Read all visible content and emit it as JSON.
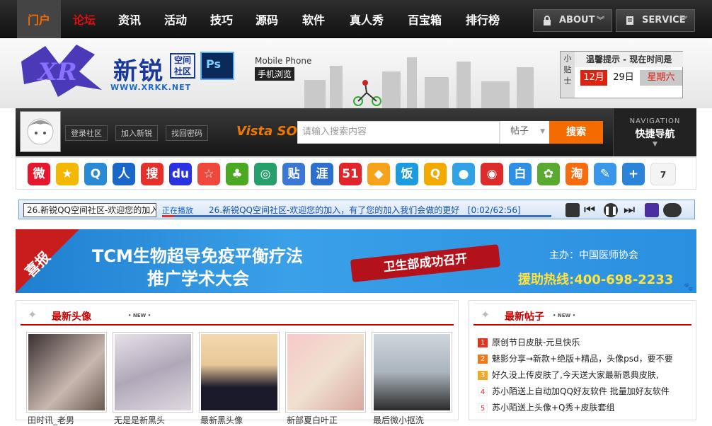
{
  "nav": [
    {
      "label": "门户",
      "state": "active"
    },
    {
      "label": "论坛",
      "state": "red"
    },
    {
      "label": "资讯",
      "state": ""
    },
    {
      "label": "活动",
      "state": ""
    },
    {
      "label": "技巧",
      "state": ""
    },
    {
      "label": "源码",
      "state": ""
    },
    {
      "label": "软件",
      "state": ""
    },
    {
      "label": "真人秀",
      "state": ""
    },
    {
      "label": "百宝箱",
      "state": ""
    },
    {
      "label": "排行榜",
      "state": ""
    }
  ],
  "top_buttons": {
    "about": "ABOUT",
    "service": "SERVICE"
  },
  "logo": {
    "name": "新锐",
    "sub": "空间社区",
    "url": "WWW.XRKK.NET",
    "ps": "Ps"
  },
  "mobile": {
    "line1": "Mobile Phone",
    "line2": "手机浏览"
  },
  "tip": {
    "side": "小贴士",
    "title": "温馨提示 - 现在时间是",
    "month": "12月",
    "day": "29日",
    "weekday": "星期六"
  },
  "user": {
    "login": "登录社区",
    "join": "加入新锐",
    "forgot": "找回密码"
  },
  "search": {
    "brand": "Vista SO",
    "placeholder": "请输入搜索内容",
    "type": "帖子",
    "button": "搜索"
  },
  "quicknav": {
    "en": "NAVIGATION",
    "cn": "快捷导航"
  },
  "apps": [
    {
      "name": "weibo-icon",
      "glyph": "微",
      "color": "#e6162d"
    },
    {
      "name": "qzone-star-icon",
      "glyph": "★",
      "color": "#f5b800"
    },
    {
      "name": "qq-weibo-icon",
      "glyph": "Q",
      "color": "#2a8ad6"
    },
    {
      "name": "renren-icon",
      "glyph": "人",
      "color": "#1a66c9"
    },
    {
      "name": "sohu-weibo-icon",
      "glyph": "搜",
      "color": "#e8302a"
    },
    {
      "name": "baidu-icon",
      "glyph": "du",
      "color": "#2932e1"
    },
    {
      "name": "favorite-star-icon",
      "glyph": "☆",
      "color": "#f0483c"
    },
    {
      "name": "kaixin-clover-icon",
      "glyph": "♣",
      "color": "#4aa821"
    },
    {
      "name": "netease-circle-icon",
      "glyph": "◎",
      "color": "#26a06a"
    },
    {
      "name": "baidu-tieba-icon",
      "glyph": "贴",
      "color": "#3b78d6"
    },
    {
      "name": "ya-icon",
      "glyph": "涯",
      "color": "#2c6fcc"
    },
    {
      "name": "51-icon",
      "glyph": "51",
      "color": "#e2232a"
    },
    {
      "name": "bookmark-icon",
      "glyph": "◆",
      "color": "#f7a21b"
    },
    {
      "name": "fan-icon",
      "glyph": "饭",
      "color": "#1b9be0"
    },
    {
      "name": "qq-location-icon",
      "glyph": "Q",
      "color": "#f2a900"
    },
    {
      "name": "qq-penguin-icon",
      "glyph": "●",
      "color": "#32a2e6"
    },
    {
      "name": "netease-icon",
      "glyph": "◉",
      "color": "#dd2a2a"
    },
    {
      "name": "bai-icon",
      "glyph": "白",
      "color": "#2d8fe6"
    },
    {
      "name": "msn-icon",
      "glyph": "✿",
      "color": "#5aaa32"
    },
    {
      "name": "taobao-icon",
      "glyph": "淘",
      "color": "#f76c0e"
    },
    {
      "name": "pen-icon",
      "glyph": "✎",
      "color": "#3a96e8"
    },
    {
      "name": "plus-icon",
      "glyph": "+",
      "color": "#2c84d8"
    }
  ],
  "apps_more": "7",
  "player": {
    "box_text": "26.新锐QQ空间社区-欢迎您的加入",
    "now": "正在播放",
    "title": "26.新锐QQ空间社区-欢迎您的加入，有了您的加入我们会做的更好",
    "time": "[0:02/62:56]",
    "progress": 0.03
  },
  "banner": {
    "tag": "喜报",
    "line1": "TCM生物超导免疫平衡疗法",
    "line2": "推广学术大会",
    "ribbon": "卫生部成功召开",
    "host": "主办：中国医师协会",
    "hotline": "援助热线:400-698-2233"
  },
  "headlines": {
    "title": "最新头像",
    "new": "• NEW •",
    "captions": [
      "田时讯_老男",
      "无是是新黑头",
      "最新黑头像",
      "新部夏白叶正",
      "最后微小抠洗"
    ]
  },
  "posts": {
    "title": "最新帖子",
    "new": "• NEW •",
    "items": [
      "原创节日皮肤-元旦快乐",
      "魅影分享→新款+绝版+精品，头像psd，要不要",
      "好久没上传皮肤了,今天送大家最新恩典皮肤,",
      "苏小陌送上自动加QQ好友软件 批量加好友软件",
      "苏小陌送上头像+Q秀+皮肤套组"
    ]
  },
  "colors": {
    "accent": "#f46b00",
    "red": "#cc0000",
    "nav_bg": "#1a1a1a",
    "banner": "#2b8fe0"
  }
}
